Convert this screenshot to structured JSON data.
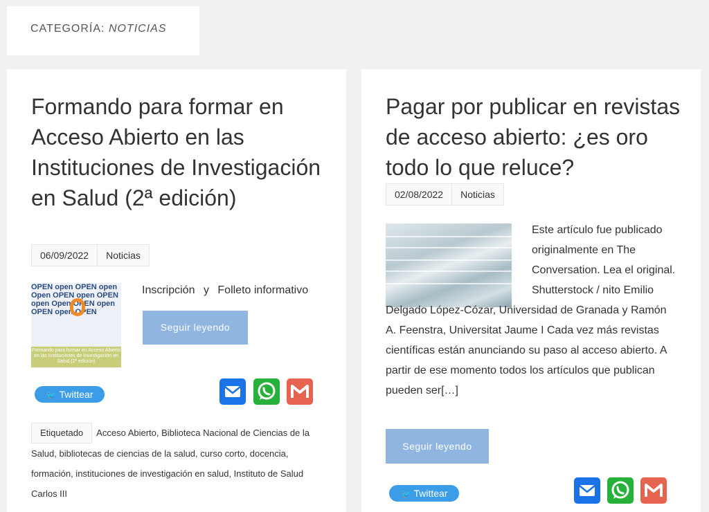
{
  "category": {
    "prefix": "CATEGORÍA:",
    "name": "NOTICIAS"
  },
  "posts": [
    {
      "title": "Formando para formar en Acceso Abierto en las Instituciones de Investigación en Salud (2ª edición)",
      "date": "06/09/2022",
      "category": "Noticias",
      "thumb_words": "OPEN open OPEN open Open OPEN open OPEN open Open OPEN open OPEN open OPEN",
      "thumb_caption": "Formando para formar en Acceso Abierto en las Instituciones de Investigación en Salud (2ª edición)",
      "links": [
        "Inscripción",
        "y",
        "Folleto informativo"
      ],
      "read_more": "Seguir leyendo",
      "tweet": "Twittear",
      "tags_label": "Etiquetado",
      "tags_text": "Acceso Abierto, Biblioteca Nacional de Ciencias de la Salud, bibliotecas de ciencias de la salud, curso corto, docencia, formación, instituciones de investigación en salud, Instituto de Salud Carlos III"
    },
    {
      "title": "Pagar por publicar en revistas de acceso abierto: ¿es oro todo lo que reluce?",
      "date": "02/08/2022",
      "category": "Noticias",
      "excerpt": "Este artículo fue publicado originalmente en The Conversation. Lea el original.   Shutterstock / nito Emilio Delgado López-Cózar, Universidad de Granada y Ramón A. Feenstra, Universitat Jaume I Cada vez más revistas científicas están anunciando su paso al acceso abierto. A partir de ese momento todos los artículos que publican pueden ser[…]",
      "read_more": "Seguir leyendo",
      "tweet": "Twittear"
    }
  ],
  "icons": {
    "email": "email-icon",
    "whatsapp": "whatsapp-icon",
    "gmail": "gmail-icon",
    "twitter": "twitter-bird-icon"
  },
  "colors": {
    "button": "#8fb5e0",
    "twitter": "#3b9ce8",
    "email": "#1a73e8",
    "whatsapp": "#25b13a",
    "gmail": "#e66350"
  }
}
